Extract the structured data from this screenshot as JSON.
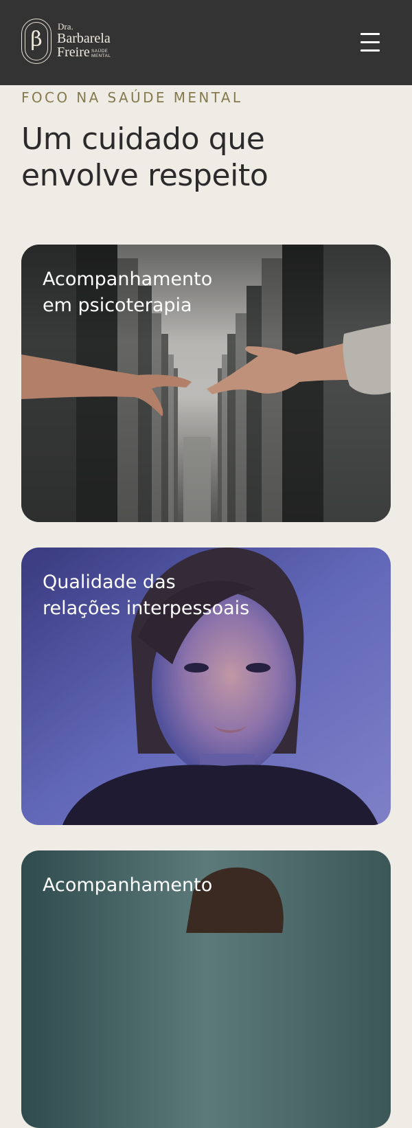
{
  "header": {
    "logo": {
      "monogram": "β",
      "prefix": "Dra.",
      "name_line1": "Barbarela",
      "name_line2": "Freire",
      "tagline_line1": "SAÚDE",
      "tagline_line2": "MENTAL"
    },
    "menu_icon": "hamburger-menu-icon",
    "background_color": "#333333"
  },
  "section": {
    "eyebrow": "FOCO NA SAÚDE MENTAL",
    "headline_line1": "Um cuidado que",
    "headline_line2": "envolve respeito"
  },
  "cards": [
    {
      "title_line1": "Acompanhamento",
      "title_line2": "em psicoterapia",
      "image": "hands-reaching-between-concrete-pillars"
    },
    {
      "title_line1": "Qualidade das",
      "title_line2": "relações interpessoais",
      "image": "woman-portrait-blue-purple-light"
    },
    {
      "title_line1": "Acompanhamento",
      "title_line2": "",
      "image": "person-portrait-teal-background"
    }
  ],
  "colors": {
    "page_background": "#efebe5",
    "eyebrow": "#857a4d",
    "headline": "#2b2b2b",
    "card_title": "#ffffff"
  }
}
